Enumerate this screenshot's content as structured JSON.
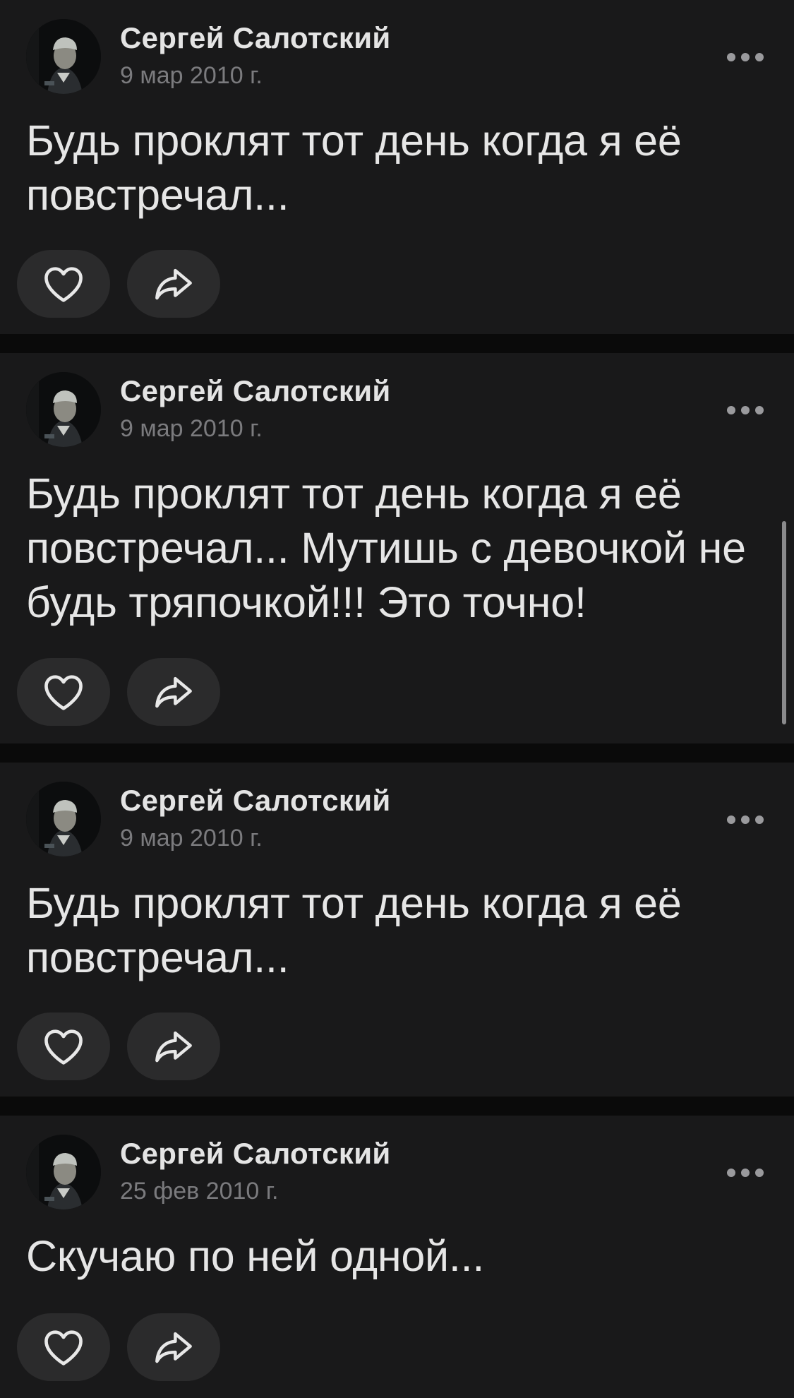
{
  "colors": {
    "background": "#0a0a0a",
    "card": "#19191a",
    "button": "#2b2b2c",
    "text": "#e6e6e6",
    "muted": "#7b7b7e"
  },
  "icons": {
    "like": "heart-outline-icon",
    "share": "share-arrow-icon",
    "menu": "more-horizontal-icon"
  },
  "posts": [
    {
      "author": "Сергей Салотский",
      "date": "9 мар 2010 г.",
      "text": "Будь проклят тот день когда я её повстречал..."
    },
    {
      "author": "Сергей Салотский",
      "date": "9 мар 2010 г.",
      "text": "Будь проклят тот день когда я её повстречал... Мутишь с девочкой не будь тряпочкой!!! Это точно!"
    },
    {
      "author": "Сергей Салотский",
      "date": "9 мар 2010 г.",
      "text": "Будь проклят тот день когда я её повстречал..."
    },
    {
      "author": "Сергей Салотский",
      "date": "25 фев 2010 г.",
      "text": "Скучаю по ней одной..."
    }
  ]
}
